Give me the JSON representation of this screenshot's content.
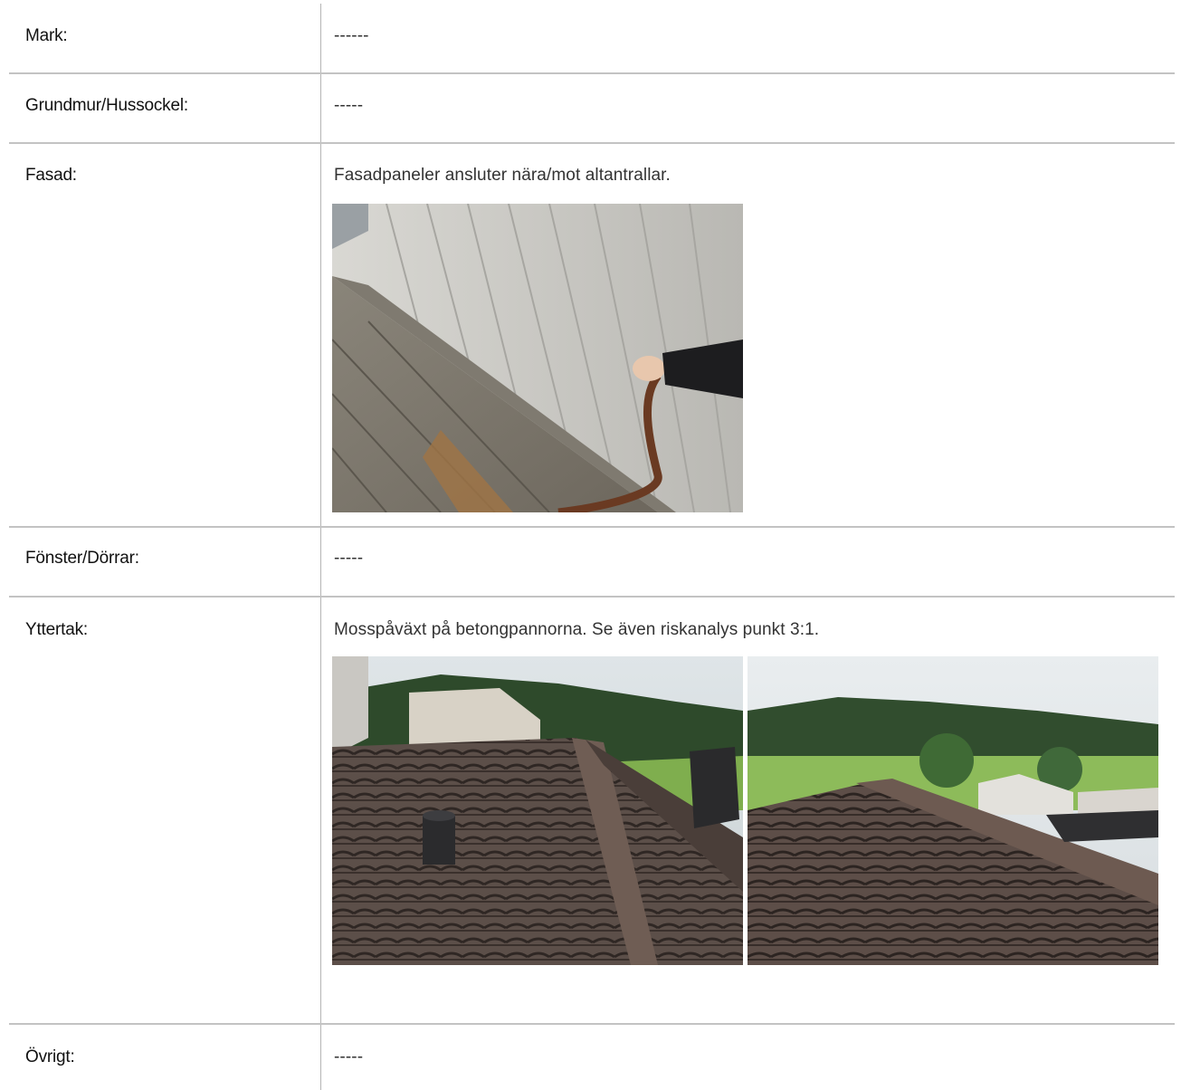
{
  "rows": [
    {
      "label": "Mark:",
      "value": "------"
    },
    {
      "label": "Grundmur/Hussockel:",
      "value": "-----"
    },
    {
      "label": "Fasad:",
      "value": "Fasadpaneler ansluter nära/mot altantrallar."
    },
    {
      "label": "Fönster/Dörrar:",
      "value": "-----"
    },
    {
      "label": "Yttertak:",
      "value": "Mosspåväxt på betongpannorna. Se även riskanalys punkt 3:1."
    },
    {
      "label": "Övrigt:",
      "value": "-----"
    }
  ]
}
